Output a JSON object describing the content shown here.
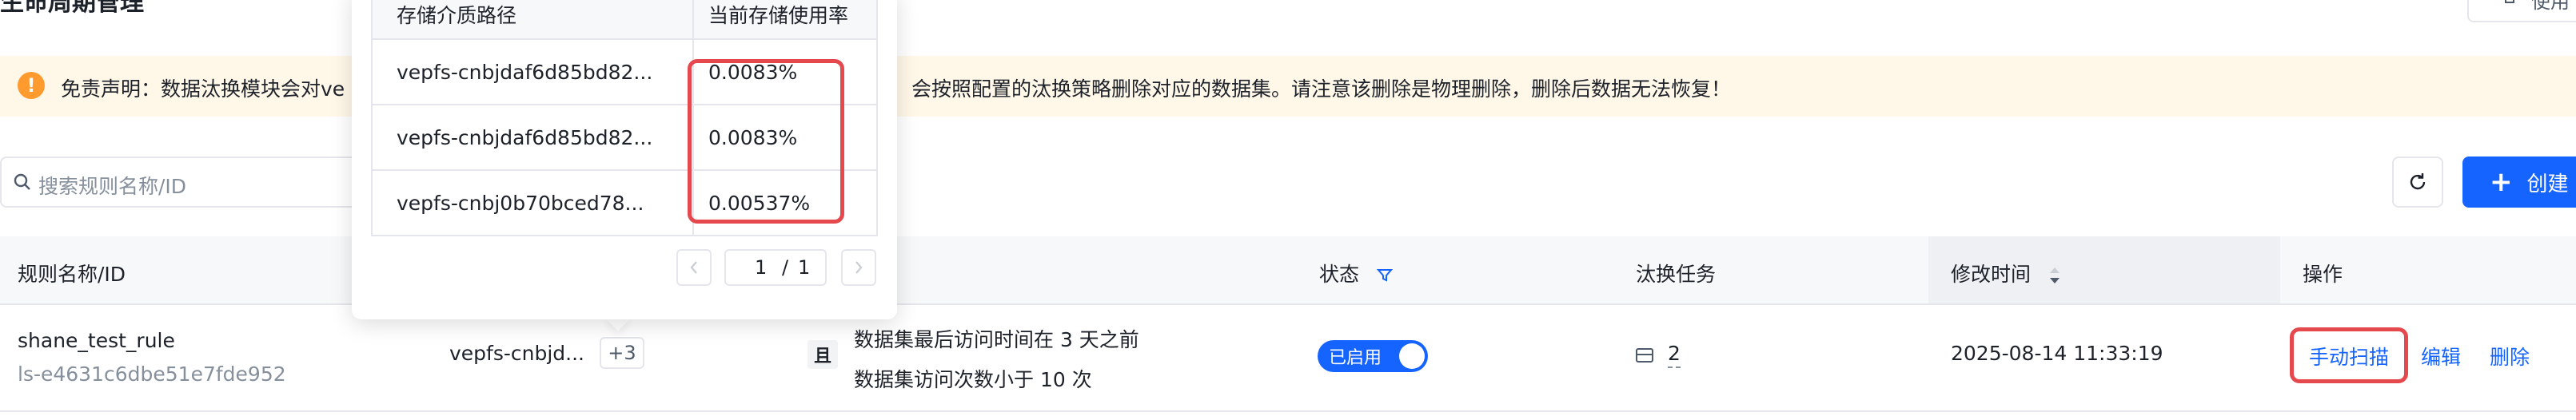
{
  "header": {
    "title": "生命周期管理",
    "help_label": "使用"
  },
  "banner": {
    "text_left": "免责声明：数据汰换模块会对ve",
    "text_right": "会按照配置的汰换策略删除对应的数据集。请注意该删除是物理删除，删除后数据无法恢复！"
  },
  "toolbar": {
    "search_placeholder": "搜索规则名称/ID",
    "create_label": "创建"
  },
  "table": {
    "columns": {
      "name": "规则名称/ID",
      "status": "状态",
      "task": "汰换任务",
      "modified": "修改时间",
      "actions": "操作"
    },
    "rows": [
      {
        "name": "shane_test_rule",
        "id": "ls-e4631c6dbe51e7fde952",
        "media": "vepfs-cnbjd...",
        "media_more": "+3",
        "logic": "且",
        "condition_1": "数据集最后访问时间在 3 天之前",
        "condition_2": "数据集访问次数小于 10 次",
        "status": "已启用",
        "task_count": "2",
        "modified": "2025-08-14 11:33:19",
        "action_scan": "手动扫描",
        "action_edit": "编辑",
        "action_delete": "删除"
      }
    ]
  },
  "popover": {
    "col_path": "存储介质路径",
    "col_usage": "当前存储使用率",
    "rows": [
      {
        "path": "vepfs-cnbjdaf6d85bd82...",
        "usage": "0.0083%"
      },
      {
        "path": "vepfs-cnbjdaf6d85bd82...",
        "usage": "0.0083%"
      },
      {
        "path": "vepfs-cnbj0b70bced78...",
        "usage": "0.00537%"
      }
    ],
    "pager": {
      "current": "1",
      "separator": "/",
      "total": "1"
    }
  },
  "colors": {
    "primary": "#1664ff",
    "warning": "#ff9a2e",
    "banner_bg": "#fff7e8",
    "highlight": "#e5484d"
  }
}
